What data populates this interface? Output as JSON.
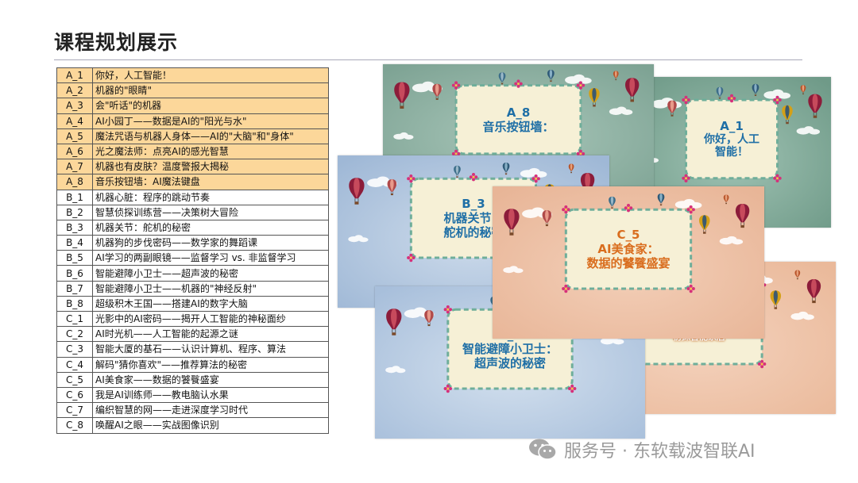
{
  "title": "课程规划展示",
  "table": {
    "rows": [
      {
        "code": "A_1",
        "name": "你好，人工智能！",
        "highlight": true
      },
      {
        "code": "A_2",
        "name": "机器的\"眼睛\"",
        "highlight": true
      },
      {
        "code": "A_3",
        "name": "会\"听话\"的机器",
        "highlight": true
      },
      {
        "code": "A_4",
        "name": "AI小园丁——数据是AI的\"阳光与水\"",
        "highlight": true
      },
      {
        "code": "A_5",
        "name": "魔法咒语与机器人身体——AI的\"大脑\"和\"身体\"",
        "highlight": true
      },
      {
        "code": "A_6",
        "name": "光之魔法师：点亮AI的感光智慧",
        "highlight": true
      },
      {
        "code": "A_7",
        "name": "机器也有皮肤？温度警报大揭秘",
        "highlight": true
      },
      {
        "code": "A_8",
        "name": "音乐按钮墙：AI魔法键盘",
        "highlight": true
      },
      {
        "code": "B_1",
        "name": "机器心脏：程序的跳动节奏",
        "highlight": false
      },
      {
        "code": "B_2",
        "name": "智慧侦探训练营——决策树大冒险",
        "highlight": false
      },
      {
        "code": "B_3",
        "name": "机器关节：舵机的秘密",
        "highlight": false
      },
      {
        "code": "B_4",
        "name": "机器狗的步伐密码——数学家的舞蹈课",
        "highlight": false
      },
      {
        "code": "B_5",
        "name": "AI学习的两副眼镜——监督学习 vs. 非监督学习",
        "highlight": false
      },
      {
        "code": "B_6",
        "name": "智能避障小卫士——超声波的秘密",
        "highlight": false
      },
      {
        "code": "B_7",
        "name": "智能避障小卫士——机器的\"神经反射\"",
        "highlight": false
      },
      {
        "code": "B_8",
        "name": "超级积木王国——搭建AI的数字大脑",
        "highlight": false
      },
      {
        "code": "C_1",
        "name": "光影中的AI密码——揭开人工智能的神秘面纱",
        "highlight": false
      },
      {
        "code": "C_2",
        "name": "AI时光机——人工智能的起源之谜",
        "highlight": false
      },
      {
        "code": "C_3",
        "name": "智能大厦的基石——认识计算机、程序、算法",
        "highlight": false
      },
      {
        "code": "C_4",
        "name": "解码\"猜你喜欢\"——推荐算法的秘密",
        "highlight": false
      },
      {
        "code": "C_5",
        "name": "AI美食家——数据的饕餮盛宴",
        "highlight": false
      },
      {
        "code": "C_6",
        "name": "我是AI训练师——教电脑认水果",
        "highlight": false
      },
      {
        "code": "C_7",
        "name": "编织智慧的网——走进深度学习时代",
        "highlight": false
      },
      {
        "code": "C_8",
        "name": "唤醒AI之眼——实战图像识别",
        "highlight": false
      }
    ]
  },
  "slides": [
    {
      "code": "A_1",
      "line1": "你好，人工",
      "line2": "智能！",
      "bg_top": "#6f9a88",
      "bg_bottom": "#9fc2b3",
      "text_color": "#1f6fa6"
    },
    {
      "code": "A_8",
      "line1": "音乐按钮墙：",
      "line2": "",
      "bg_top": "#7ea394",
      "bg_bottom": "#a8c6b9",
      "text_color": "#1f6fa6"
    },
    {
      "code": "C_6",
      "line1": "发现身边的智慧生活：",
      "line2": "初探智能家居",
      "bg_top": "#eab99a",
      "bg_bottom": "#f4d2bd",
      "text_color": "#ffffff"
    },
    {
      "code": "B_3",
      "line1": "机器关节：",
      "line2": "舵机的秘密",
      "bg_top": "#9fb8d6",
      "bg_bottom": "#cddbeb",
      "text_color": "#1f6fa6"
    },
    {
      "code": "B_6",
      "line1": "智能避障小卫士：",
      "line2": "超声波的秘密",
      "bg_top": "#a8bfdb",
      "bg_bottom": "#d3e0ee",
      "text_color": "#1f6fa6"
    },
    {
      "code": "C_5",
      "line1": "AI美食家：",
      "line2": "数据的饕餮盛宴",
      "bg_top": "#e8b597",
      "bg_bottom": "#f3cfb8",
      "text_color": "#d96d1e"
    }
  ],
  "watermark": {
    "text": "服务号 · 东软载波智联AI"
  }
}
